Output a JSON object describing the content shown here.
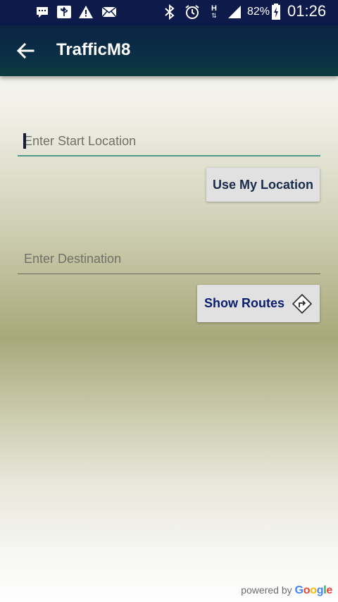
{
  "status_bar": {
    "battery": "82%",
    "time": "01:26",
    "network": "H",
    "icons": [
      "messenger-icon",
      "usb-icon",
      "warning-icon",
      "email-icon",
      "bluetooth-icon",
      "alarm-icon",
      "network-h-icon",
      "signal-icon",
      "battery-charging-icon"
    ]
  },
  "app_bar": {
    "title": "TrafficM8",
    "back_icon": "arrow-back-icon"
  },
  "start": {
    "placeholder": "Enter Start Location",
    "value": ""
  },
  "use_location_label": "Use My Location",
  "destination": {
    "placeholder": "Enter Destination",
    "value": ""
  },
  "show_routes_label": "Show Routes",
  "route_icon": "directions-icon",
  "footer": {
    "powered_by": "powered by",
    "google": [
      "G",
      "o",
      "o",
      "g",
      "l",
      "e"
    ]
  },
  "colors": {
    "status_bar": "#0d1a4a",
    "app_bar": "#0a2f45",
    "button_text_primary": "#1a2a4a",
    "button_text_accent": "#0a1e6e",
    "start_underline": "#4f9a8a",
    "dest_underline": "#6d6a58",
    "google": [
      "#4285F4",
      "#EA4335",
      "#FBBC05",
      "#4285F4",
      "#34A853",
      "#EA4335"
    ]
  }
}
